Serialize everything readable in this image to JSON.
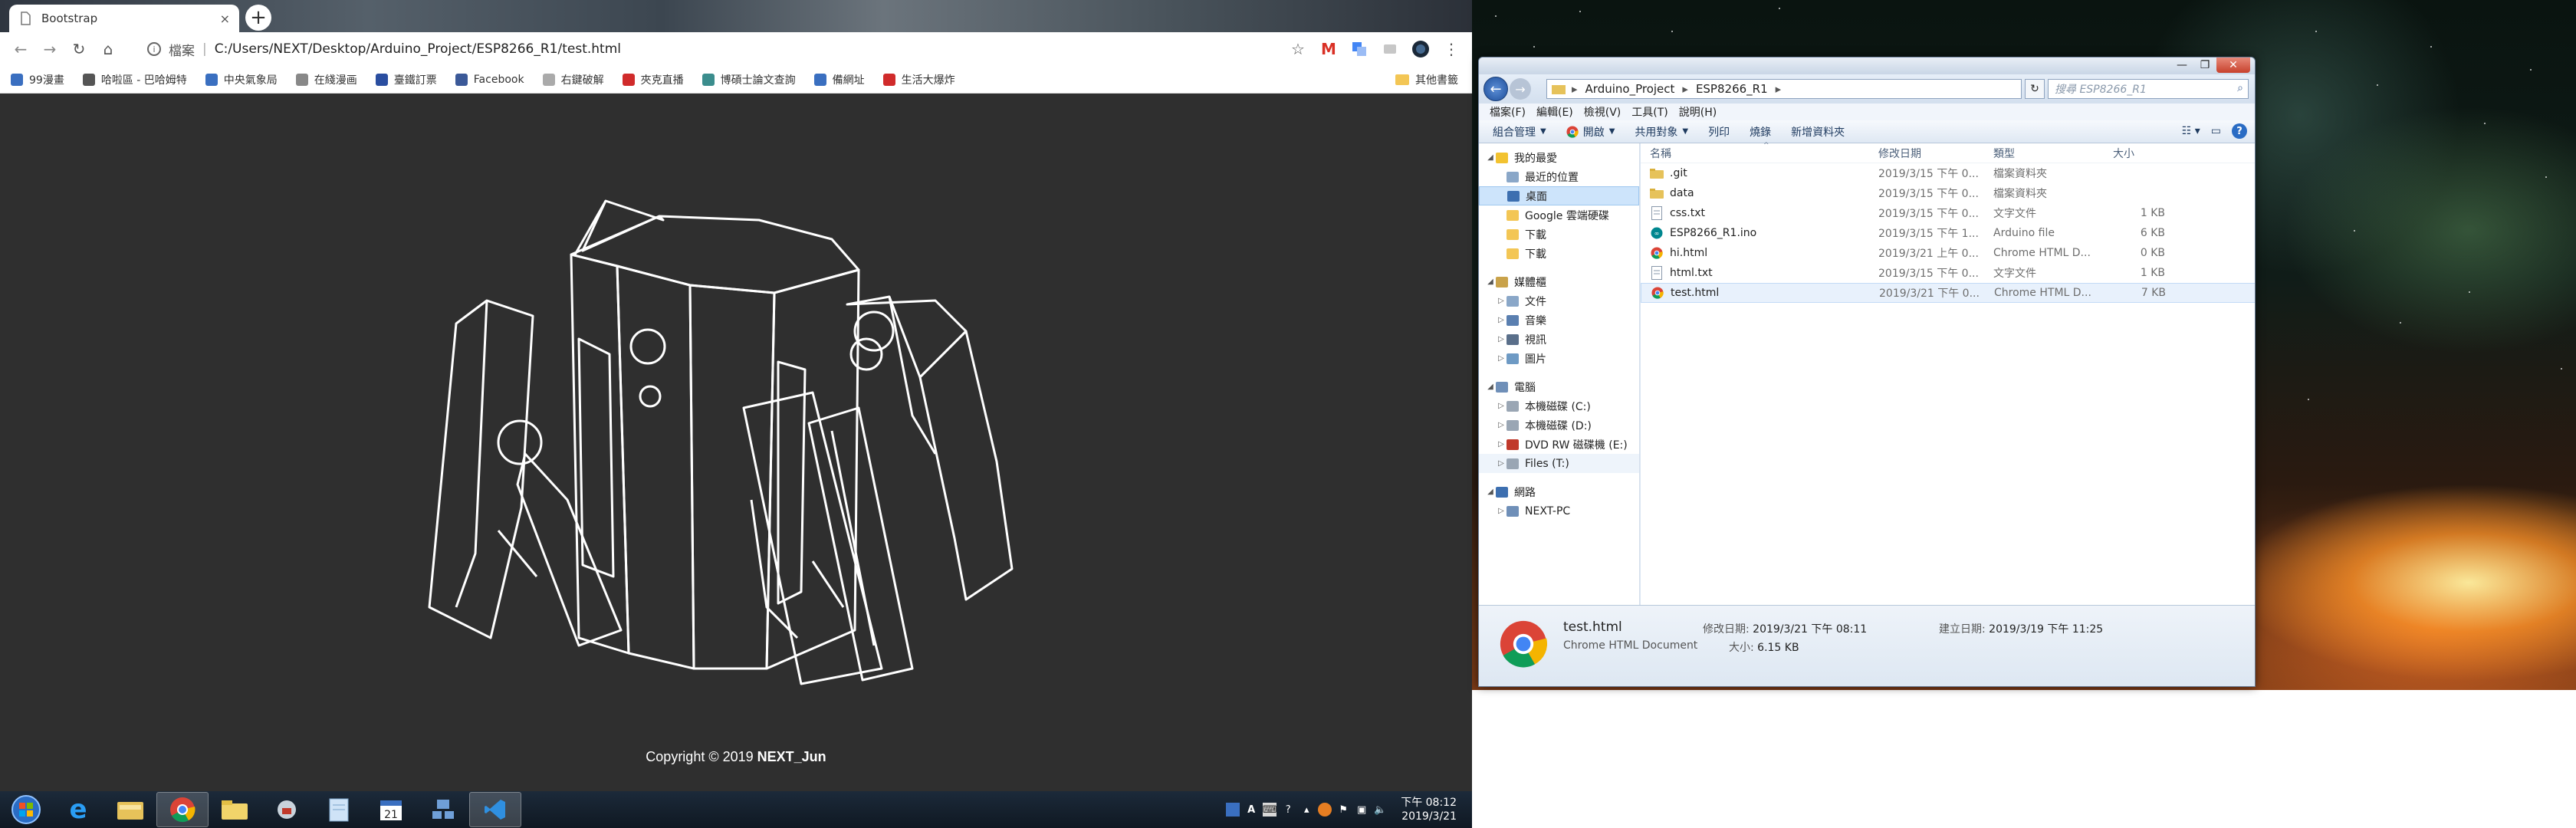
{
  "browser": {
    "tab_title": "Bootstrap",
    "tab_close": "×",
    "new_tab": "+",
    "url_scheme": "檔案",
    "url_sep": "|",
    "url": "C:/Users/NEXT/Desktop/Arduino_Project/ESP8266_R1/test.html",
    "bookmarks": [
      {
        "label": "99漫畫",
        "color": "#3a6fc0"
      },
      {
        "label": "哈啦區 - 巴哈姆特",
        "color": "#555"
      },
      {
        "label": "中央氣象局",
        "color": "#3a6fc0"
      },
      {
        "label": "在綫漫画",
        "color": "#888"
      },
      {
        "label": "臺鐵訂票",
        "color": "#2a4ea0"
      },
      {
        "label": "Facebook",
        "color": "#3b5998"
      },
      {
        "label": "右鍵破解",
        "color": "#aaa"
      },
      {
        "label": "夾克直播",
        "color": "#d02b2b"
      },
      {
        "label": "博碩士論文查詢",
        "color": "#3b8d8d"
      },
      {
        "label": "備網址",
        "color": "#3a6fc0"
      },
      {
        "label": "生活大爆炸",
        "color": "#d02b2b"
      }
    ],
    "other_bookmarks": "其他書籤",
    "footer_text": "Copyright © 2019 ",
    "footer_author": "NEXT_Jun"
  },
  "taskbar": {
    "clock_time": "下午 08:12",
    "clock_date": "2019/3/21",
    "apps": [
      "start-orb-icon",
      "ie-icon",
      "explorer-icon",
      "chrome-icon",
      "folder-icon",
      "tools-icon",
      "notepad-icon",
      "calendar-icon",
      "network-icon",
      "vscode-icon"
    ]
  },
  "explorer": {
    "breadcrumb": [
      "Arduino_Project",
      "ESP8266_R1"
    ],
    "search_placeholder": "搜尋 ESP8266_R1",
    "menu": [
      "檔案(F)",
      "編輯(E)",
      "檢視(V)",
      "工具(T)",
      "說明(H)"
    ],
    "commands": [
      "組合管理",
      "開啟",
      "共用對象",
      "列印",
      "燒錄",
      "新增資料夾"
    ],
    "nav": [
      {
        "label": "我的最愛",
        "level": 0,
        "arrow": "◢",
        "icon": "favorites-star-icon",
        "color": "#f2c230"
      },
      {
        "label": "最近的位置",
        "level": 1,
        "arrow": "",
        "icon": "recent-places-icon",
        "color": "#8aa7c8"
      },
      {
        "label": "桌面",
        "level": 1,
        "arrow": "",
        "icon": "desktop-icon",
        "color": "#3d6fb0",
        "selected": true
      },
      {
        "label": "Google 雲端硬碟",
        "level": 1,
        "arrow": "",
        "icon": "google-drive-icon",
        "color": "#f3c655"
      },
      {
        "label": "下載",
        "level": 1,
        "arrow": "",
        "icon": "downloads-icon",
        "color": "#f3c655"
      },
      {
        "label": "下載",
        "level": 1,
        "arrow": "",
        "icon": "downloads-icon",
        "color": "#f3c655"
      },
      {
        "label": "媒體櫃",
        "level": 0,
        "arrow": "◢",
        "icon": "libraries-icon",
        "color": "#c9a24a",
        "gap": true
      },
      {
        "label": "文件",
        "level": 1,
        "arrow": "▷",
        "icon": "documents-icon",
        "color": "#8aa7c8"
      },
      {
        "label": "音樂",
        "level": 1,
        "arrow": "▷",
        "icon": "music-icon",
        "color": "#5a7fb0"
      },
      {
        "label": "視訊",
        "level": 1,
        "arrow": "▷",
        "icon": "videos-icon",
        "color": "#5a6f8a"
      },
      {
        "label": "圖片",
        "level": 1,
        "arrow": "▷",
        "icon": "pictures-icon",
        "color": "#6e9ac4"
      },
      {
        "label": "電腦",
        "level": 0,
        "arrow": "◢",
        "icon": "computer-icon",
        "color": "#6f8fb8",
        "gap": true
      },
      {
        "label": "本機磁碟 (C:)",
        "level": 1,
        "arrow": "▷",
        "icon": "drive-c-icon",
        "color": "#9aa6b4"
      },
      {
        "label": "本機磁碟 (D:)",
        "level": 1,
        "arrow": "▷",
        "icon": "drive-d-icon",
        "color": "#9aa6b4"
      },
      {
        "label": "DVD RW 磁碟機 (E:)",
        "level": 1,
        "arrow": "▷",
        "icon": "dvd-drive-icon",
        "color": "#c0392b"
      },
      {
        "label": "Files (T:)",
        "level": 1,
        "arrow": "▷",
        "icon": "network-drive-icon",
        "color": "#9aa6b4",
        "hover": true
      },
      {
        "label": "網路",
        "level": 0,
        "arrow": "◢",
        "icon": "network-icon",
        "color": "#3d6fb0",
        "gap": true
      },
      {
        "label": "NEXT-PC",
        "level": 1,
        "arrow": "▷",
        "icon": "pc-icon",
        "color": "#6f8fb8"
      }
    ],
    "columns": {
      "name": "名稱",
      "date": "修改日期",
      "type": "類型",
      "size": "大小"
    },
    "files": [
      {
        "name": ".git",
        "date": "2019/3/15 下午 0...",
        "type": "檔案資料夾",
        "size": "",
        "icon": "folder-icon"
      },
      {
        "name": "data",
        "date": "2019/3/15 下午 0...",
        "type": "檔案資料夾",
        "size": "",
        "icon": "folder-icon"
      },
      {
        "name": "css.txt",
        "date": "2019/3/15 下午 0...",
        "type": "文字文件",
        "size": "1 KB",
        "icon": "text-file-icon"
      },
      {
        "name": "ESP8266_R1.ino",
        "date": "2019/3/15 下午 1...",
        "type": "Arduino file",
        "size": "6 KB",
        "icon": "arduino-file-icon"
      },
      {
        "name": "hi.html",
        "date": "2019/3/21 上午 0...",
        "type": "Chrome HTML D...",
        "size": "0 KB",
        "icon": "chrome-html-icon"
      },
      {
        "name": "html.txt",
        "date": "2019/3/15 下午 0...",
        "type": "文字文件",
        "size": "1 KB",
        "icon": "text-file-icon"
      },
      {
        "name": "test.html",
        "date": "2019/3/21 下午 0...",
        "type": "Chrome HTML D...",
        "size": "7 KB",
        "icon": "chrome-html-icon",
        "selected": true
      }
    ],
    "details": {
      "name": "test.html",
      "type": "Chrome HTML Document",
      "modified_label": "修改日期:",
      "modified": "2019/3/21 下午 08:11",
      "created_label": "建立日期:",
      "created": "2019/3/19 下午 11:25",
      "size_label": "大小:",
      "size": "6.15 KB"
    }
  }
}
